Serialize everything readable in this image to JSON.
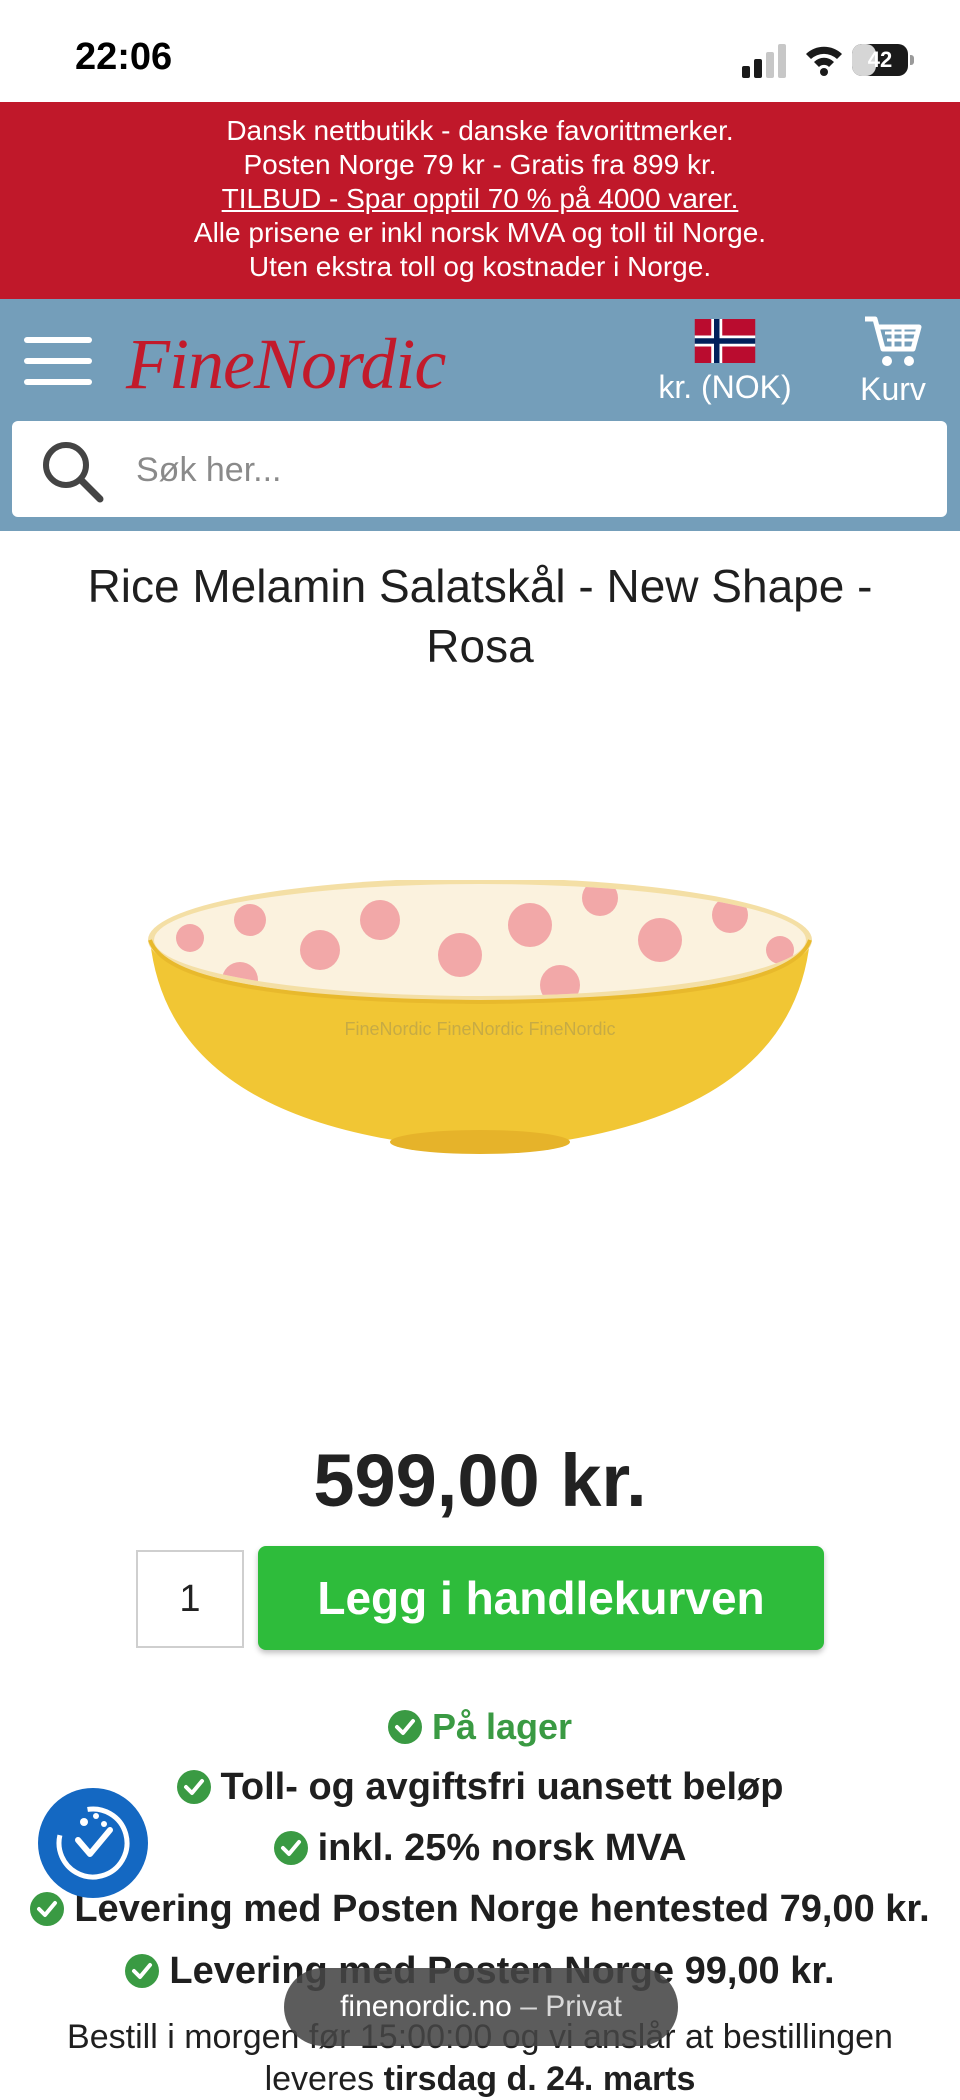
{
  "status_bar": {
    "time": "22:06",
    "battery": "42",
    "battery_level": 0.42
  },
  "promo": {
    "line1": "Dansk nettbutikk - danske favorittmerker.",
    "line2": "Posten Norge 79 kr - Gratis fra 899 kr.",
    "link": "TILBUD - Spar opptil 70 % på 4000 varer.",
    "line4": "Alle prisene er inkl norsk MVA og toll til Norge.",
    "line5": "Uten ekstra toll og kostnader i Norge."
  },
  "header": {
    "logo": "FineNordic",
    "currency": "kr. (NOK)",
    "cart": "Kurv",
    "menu_icon": "hamburger-icon",
    "cart_icon": "cart-icon",
    "flag_icon": "norway-flag-icon"
  },
  "search": {
    "placeholder": "Søk her..."
  },
  "product": {
    "title": "Rice Melamin Salatskål - New Shape - Rosa",
    "image_watermark": "FineNordic FineNordic FineNordic",
    "price": "599,00 kr.",
    "quantity": "1",
    "add_to_cart": "Legg i handlekurven"
  },
  "features": {
    "stock": "På lager",
    "customs": "Toll- og avgiftsfri uansett beløp",
    "vat": "inkl. 25% norsk MVA",
    "delivery_pickup": "Levering med Posten Norge hentested 79,00 kr.",
    "delivery_home": "Levering med Posten Norge 99,00 kr."
  },
  "delivery_note": {
    "prefix": "Bestill i morgen før 15:00:00 og vi anslår at bestillingen",
    "line2_prefix": "leveres ",
    "date": "tirsdag d. 24. marts"
  },
  "browser_toast": {
    "domain": "finenordic.no",
    "mode": "– Privat"
  },
  "colors": {
    "promo_bg": "#c0182a",
    "header_bg": "#749eba",
    "logo": "#c21a2b",
    "button": "#2ebc3b",
    "stock_green": "#3a9a43",
    "accessibility": "#1468c2"
  }
}
